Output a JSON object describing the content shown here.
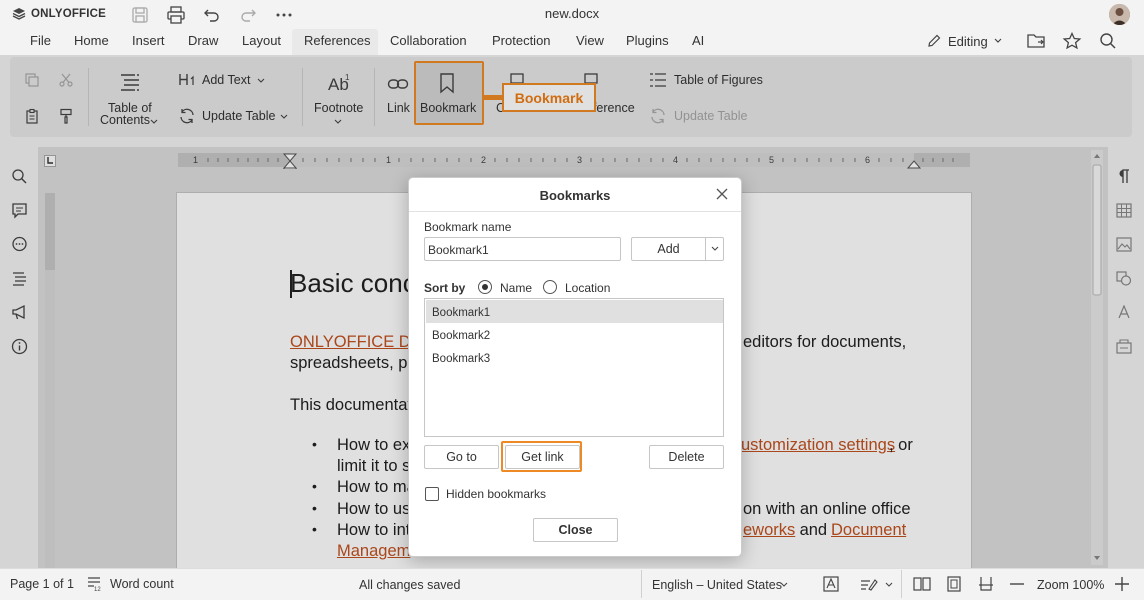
{
  "titlebar": {
    "brand": "ONLYOFFICE",
    "doc_title": "new.docx"
  },
  "menu": {
    "items": [
      "File",
      "Home",
      "Insert",
      "Draw",
      "Layout",
      "References",
      "Collaboration",
      "Protection",
      "View",
      "Plugins",
      "AI"
    ],
    "active": "References",
    "editing_label": "Editing"
  },
  "toolbar": {
    "add_text": "Add Text",
    "update_table": "Update Table",
    "toc_line1": "Table of",
    "toc_line2": "Contents",
    "footnote": "Footnote",
    "link": "Link",
    "bookmark": "Bookmark",
    "cross_reference_partial": "eference",
    "caption_partial": "C",
    "table_of_figures": "Table of Figures",
    "update_table_figures": "Update Table"
  },
  "callout": {
    "label": "Bookmark"
  },
  "ruler": {
    "numbers": [
      "1",
      "1",
      "2",
      "3",
      "4",
      "5",
      "6"
    ]
  },
  "document": {
    "heading": "Basic conc",
    "p1_link": "ONLYOFFICE D",
    "p1_rest": "editors for documents,",
    "p1_line2": "spreadsheets, pr",
    "p2": "This documentati",
    "bullets": [
      {
        "a": "How to ex",
        "link": "ustomization settings",
        "b": ", or"
      },
      {
        "a": "limit it to s"
      },
      {
        "a": "How to ma"
      },
      {
        "a": "How to us",
        "b": "on with an online office"
      },
      {
        "a": "How to int",
        "link": "eworks",
        "b": " and ",
        "link2": "Document"
      },
      {
        "link": "Managem"
      }
    ]
  },
  "dialog": {
    "title": "Bookmarks",
    "name_label": "Bookmark name",
    "name_value": "Bookmark1",
    "add_button": "Add",
    "sort_by_label": "Sort by",
    "sort_name": "Name",
    "sort_location": "Location",
    "sort_selected": "Name",
    "bookmarks": [
      "Bookmark1",
      "Bookmark2",
      "Bookmark3"
    ],
    "selected_bookmark": "Bookmark1",
    "goto_button": "Go to",
    "getlink_button": "Get link",
    "delete_button": "Delete",
    "hidden_label": "Hidden bookmarks",
    "hidden_checked": false,
    "close_button": "Close"
  },
  "statusbar": {
    "page": "Page 1 of 1",
    "word_count": "Word count",
    "saved": "All changes saved",
    "language": "English – United States",
    "zoom": "Zoom 100%"
  },
  "colors": {
    "accent_orange": "#ee8a25",
    "link": "#c2511f"
  }
}
